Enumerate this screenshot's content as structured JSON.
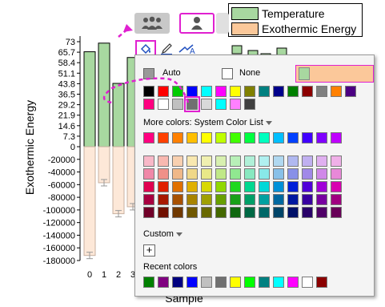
{
  "chart": {
    "y_axis_title": "Exothermic Energy",
    "x_axis_title": "Sample",
    "y_ticks_upper": [
      "73",
      "65.7",
      "58.4",
      "51.1",
      "43.8",
      "36.5",
      "29.2",
      "21.9",
      "14.6",
      "7.3",
      "0"
    ],
    "y_ticks_lower": [
      "-20000",
      "-40000",
      "-60000",
      "-80000",
      "-100000",
      "-120000",
      "-140000",
      "-160000",
      "-180000"
    ],
    "x_ticks": [
      "0",
      "1",
      "2",
      "3"
    ]
  },
  "chart_data": {
    "type": "bar",
    "categories": [
      "0",
      "1",
      "2",
      "3"
    ],
    "series": [
      {
        "name": "Temperature",
        "values": [
          66,
          72,
          44,
          62
        ],
        "color": "#a8d8a0"
      },
      {
        "name": "Exothermic Energy",
        "values": [
          -172000,
          -57000,
          -106000,
          -95000
        ],
        "color": "#fde8d8"
      }
    ],
    "xlabel": "Sample",
    "ylabel": "Exothermic Energy"
  },
  "legend": {
    "items": [
      {
        "label": "Temperature",
        "color": "#a8d8a0"
      },
      {
        "label": "Exothermic Energy",
        "color": "#fbc89a"
      }
    ]
  },
  "tabs": [
    {
      "icon": "group-icon"
    },
    {
      "icon": "person-icon"
    }
  ],
  "toolbar": {
    "fill_icon": "paint-bucket-icon",
    "pen_icon": "pen-icon",
    "text_icon": "text-color-icon"
  },
  "color_picker": {
    "auto_label": "Auto",
    "auto_color": "#999999",
    "none_label": "None",
    "current_color": "#a8d8a0",
    "accent_border": "#e020d0",
    "basic_colors": [
      "#000000",
      "#ff0000",
      "#00cc00",
      "#0000ff",
      "#00ffff",
      "#ff00ff",
      "#ffff00",
      "#808000",
      "#008080",
      "#00008b",
      "#008000",
      "#8b0000",
      "#808080",
      "#ff8000",
      "#4b0082",
      "#ff0080",
      "#ffffff",
      "#c0c0c0",
      "#707070",
      "#d9d9d9",
      "#00ffff",
      "#ff80ff",
      "#404040"
    ],
    "selected_basic_index": 18,
    "more_colors_label": "More colors: System Color List",
    "system_row": [
      "#ff0080",
      "#ff4000",
      "#ff8000",
      "#ffbf00",
      "#ffff00",
      "#bfff00",
      "#40ff00",
      "#00ff40",
      "#00ffbf",
      "#00bfff",
      "#0040ff",
      "#4000ff",
      "#8000ff",
      "#bf00ff"
    ],
    "shades": [
      [
        "#f8b8c8",
        "#f8b8b0",
        "#f8d0b0",
        "#f8e8b0",
        "#f0f0b0",
        "#d8f0b0",
        "#b8f0b8",
        "#b0f0d8",
        "#b0f0f0",
        "#b0d8f0",
        "#b0b8f0",
        "#c0b0f0",
        "#e0b0f0",
        "#f0b0e8"
      ],
      [
        "#f088a8",
        "#f09088",
        "#f0b888",
        "#f0d888",
        "#e8e888",
        "#c0e888",
        "#90e890",
        "#88e8c0",
        "#88e8e8",
        "#88c0e8",
        "#8890e8",
        "#a088e8",
        "#d088e8",
        "#e888d8"
      ],
      [
        "#e00050",
        "#e02000",
        "#e07000",
        "#e0b000",
        "#d8d800",
        "#90d800",
        "#20d820",
        "#00d890",
        "#00d8d8",
        "#0090d8",
        "#0020d8",
        "#5000d8",
        "#a000d8",
        "#d800b0"
      ],
      [
        "#a80040",
        "#a81800",
        "#a85000",
        "#a88400",
        "#a0a000",
        "#68a000",
        "#18a018",
        "#00a068",
        "#00a0a0",
        "#0068a0",
        "#0018a0",
        "#3800a0",
        "#7800a0",
        "#a00080"
      ],
      [
        "#700028",
        "#701000",
        "#703800",
        "#705800",
        "#686800",
        "#446800",
        "#106810",
        "#006844",
        "#006868",
        "#004468",
        "#001068",
        "#280068",
        "#500068",
        "#680058"
      ]
    ],
    "custom_label": "Custom",
    "add_label": "+",
    "recent_label": "Recent colors",
    "recent_colors": [
      "#008000",
      "#800080",
      "#000080",
      "#0000ff",
      "#c0c0c0",
      "#707070",
      "#ffff00",
      "#00ff00",
      "#008080",
      "#00ffff",
      "#ff00ff",
      "#ffffff",
      "#8b0000"
    ]
  }
}
